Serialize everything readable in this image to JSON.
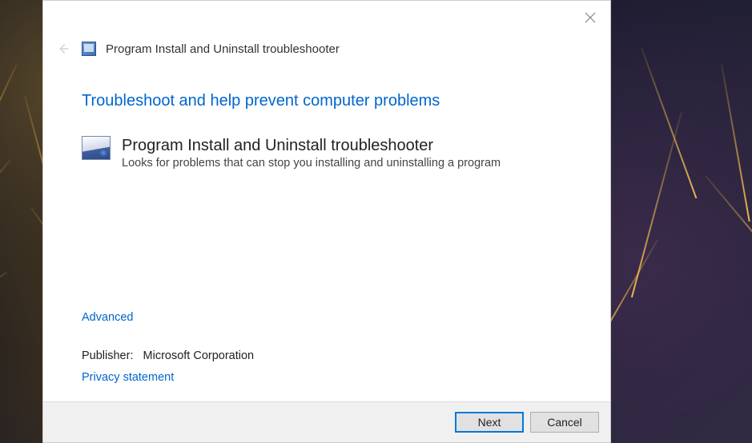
{
  "header": {
    "title": "Program Install and Uninstall troubleshooter"
  },
  "main": {
    "heading": "Troubleshoot and help prevent computer problems",
    "tool_title": "Program Install and Uninstall troubleshooter",
    "tool_description": "Looks for problems that can stop you installing and uninstalling a program"
  },
  "links": {
    "advanced": "Advanced",
    "privacy": "Privacy statement"
  },
  "publisher": {
    "label": "Publisher:",
    "value": "Microsoft Corporation"
  },
  "buttons": {
    "next": "Next",
    "cancel": "Cancel"
  }
}
